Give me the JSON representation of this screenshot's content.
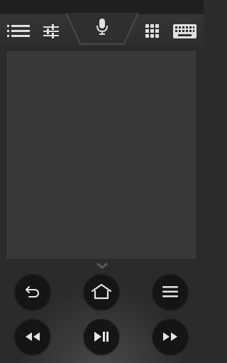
{
  "header": {
    "icons": [
      "list-icon",
      "sliders-icon",
      "microphone-icon",
      "apps-grid-icon",
      "keyboard-icon"
    ]
  },
  "trackpad": {},
  "controls": {
    "icons": [
      "back-icon",
      "home-icon",
      "menu-icon",
      "rewind-icon",
      "play-pause-icon",
      "fast-forward-icon"
    ]
  },
  "colors": {
    "background": "#2b2b2b",
    "trackpad": "#393939",
    "button": "#151515",
    "icon": "#e6e6e6"
  }
}
